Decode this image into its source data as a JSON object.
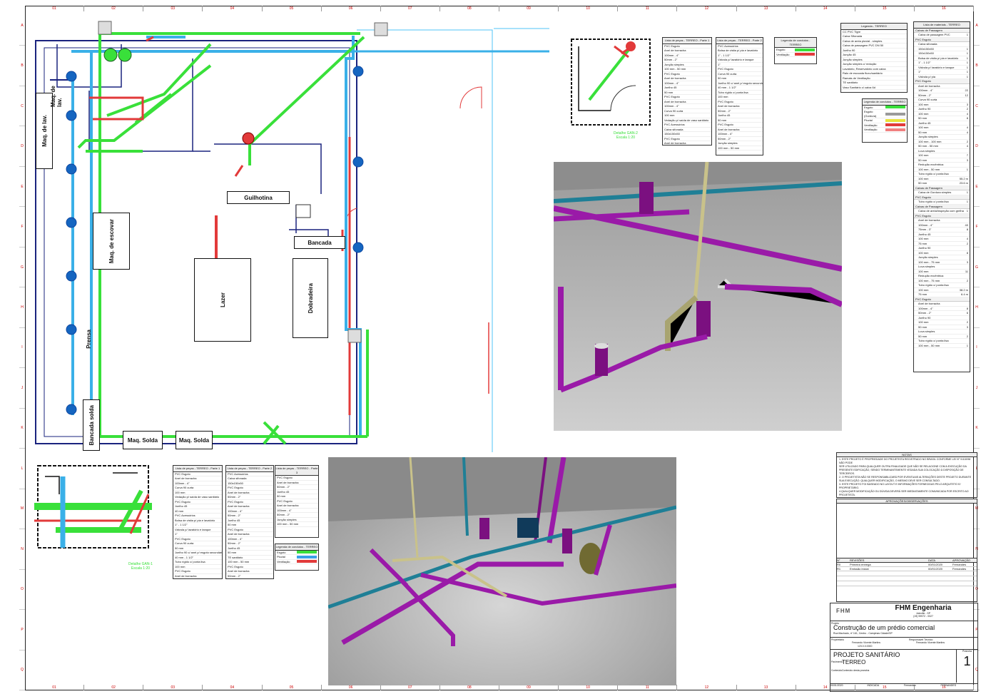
{
  "columns": [
    "01",
    "02",
    "03",
    "04",
    "05",
    "06",
    "07",
    "08",
    "09",
    "10",
    "11",
    "12",
    "13",
    "14",
    "15",
    "16"
  ],
  "rows": [
    "A",
    "B",
    "C",
    "D",
    "E",
    "F",
    "G",
    "H",
    "I",
    "J",
    "K",
    "L",
    "M",
    "N",
    "O",
    "P",
    "Q"
  ],
  "plan": {
    "rooms": {
      "maq_lavar": "Maq. de lav.",
      "maq_lavar2": "Maq. de lav.",
      "maq_escovar": "Maq. de escovar",
      "guilhotina": "Guilhotina",
      "bancada": "Bancada",
      "lazer": "Lazer",
      "dobradeira": "Dobradeira",
      "bancada_solda": "Bancada solda",
      "maq_solda1": "Maq. Solda",
      "maq_solda2": "Maq. Solda",
      "prensa": "Prensa"
    },
    "detail_gan2": {
      "title": "Detalhe GAN-2",
      "scale": "Escala 1:20"
    },
    "detail_gan1": {
      "title": "Detalhe GAN-1",
      "scale": "Escala 1:20"
    }
  },
  "legend_small": {
    "title": "Legenda de condutos - TERREO",
    "items": [
      {
        "label": "Esgoto",
        "color": "#39e03a"
      },
      {
        "label": "Ventilação",
        "color": "#e23a3a"
      }
    ]
  },
  "legend_pipes": {
    "title": "Legenda de condutos - TERREO",
    "items": [
      {
        "label": "Esgoto",
        "color": "#39e03a"
      },
      {
        "label": "Esgoto (Gordura)",
        "color": "#9a9a9a"
      },
      {
        "label": "Pluvial",
        "color": "#e8e23a"
      },
      {
        "label": "Ventilação",
        "color": "#e23a3a"
      },
      {
        "label": "Ventilação",
        "color": "#f08080"
      }
    ]
  },
  "legend_lower": {
    "title": "Legenda de condutos - TERREO",
    "items": [
      {
        "label": "Esgoto",
        "color": "#39e03a"
      },
      {
        "label": "Pluvial",
        "color": "#3aa0e8"
      },
      {
        "label": "Ventilação",
        "color": "#e23a3a"
      }
    ]
  },
  "legend_symbols": {
    "title": "Legenda - TERREO",
    "items": [
      "CC PVC Tigre",
      "Caixa Sifonada",
      "Caixa de areia pluvial - simples",
      "Caixa de passagem PVC DN 50",
      "Joelho 90",
      "Junção 45",
      "Junção simples",
      "Junção simples c/ redução",
      "Lavatório, Reservatório com caixa",
      "Ralo de escoada fluxo/sanitário",
      "Ramais de Ventilação",
      "TE sanitário",
      "Vaso Sanitário c/ caixa 6d"
    ]
  },
  "material_list": {
    "title": "Lista de materiais - TERREO",
    "sections": [
      {
        "head": "Caixas de Passagem",
        "rows": [
          [
            "Caixa de passagem PVC",
            "1"
          ]
        ]
      },
      {
        "head": "PVC Esgoto",
        "rows": [
          [
            "Caixa sifonada",
            ""
          ],
          [
            "150x150x50",
            "1"
          ],
          [
            "150x150x50",
            "1"
          ],
          [
            "Bolsa de visita p/ pia e lavatório",
            "1"
          ],
          [
            "1\" - 1 1/2\"",
            "1"
          ],
          [
            "Válvula p/ lavatório e tanque",
            "1"
          ],
          [
            "1\"",
            "1"
          ],
          [
            "Válvula p/ pia",
            "1"
          ]
        ]
      },
      {
        "head": "PVC Esgoto",
        "rows": [
          [
            "Anel de borracha",
            ""
          ],
          [
            "100mm - 4\"",
            "22"
          ],
          [
            "50mm - 2\"",
            "12"
          ],
          [
            "Curva 90 curta",
            ""
          ],
          [
            "100 mm",
            "3"
          ],
          [
            "Joelho 90",
            "2"
          ],
          [
            "100 mm",
            "4"
          ],
          [
            "50 mm",
            "8"
          ],
          [
            "Joelho 45",
            ""
          ],
          [
            "100 mm",
            "4"
          ],
          [
            "50 mm",
            "4"
          ],
          [
            "Junção simples",
            ""
          ],
          [
            "100 mm - 100 mm",
            "2"
          ],
          [
            "50 mm - 50 mm",
            "4"
          ],
          [
            "Luva simples",
            ""
          ],
          [
            "100 mm",
            "7"
          ],
          [
            "50 mm",
            "3"
          ],
          [
            "Redução excêntrica",
            ""
          ],
          [
            "100 mm - 50 mm",
            "1"
          ],
          [
            "Tubo rígido c/ ponta lisa",
            ""
          ],
          [
            "100 mm",
            "55.2 m"
          ],
          [
            "50 mm",
            "23.6 m"
          ]
        ]
      },
      {
        "head": "Caixas de Passagem",
        "rows": [
          [
            "Caixa de Gordura simples",
            "1"
          ]
        ]
      },
      {
        "head": "PVC Esgoto",
        "rows": [
          [
            "Tubo rígido c/ ponta lisa",
            "1"
          ]
        ]
      },
      {
        "head": "Caixas de Passagem",
        "rows": [
          [
            "Caixa de areia/inspeção com grelha",
            "1"
          ]
        ]
      },
      {
        "head": "PVC Esgoto",
        "rows": [
          [
            "Anel de borracha",
            ""
          ],
          [
            "100mm - 4\"",
            "40"
          ],
          [
            "75mm - 3\"",
            "8"
          ],
          [
            "Joelho 45",
            ""
          ],
          [
            "100 mm",
            "4"
          ],
          [
            "75 mm",
            "2"
          ],
          [
            "Joelho 90",
            ""
          ],
          [
            "100 mm",
            "8"
          ],
          [
            "Junção simples",
            ""
          ],
          [
            "100 mm - 75 mm",
            "3"
          ],
          [
            "Luva simples",
            ""
          ],
          [
            "100 mm",
            "11"
          ],
          [
            "Redução excêntrica",
            ""
          ],
          [
            "100 mm - 75 mm",
            "2"
          ],
          [
            "Tubo rígido c/ ponta lisa",
            ""
          ],
          [
            "100 mm",
            "38.2 m"
          ],
          [
            "75 mm",
            "6.4 m"
          ]
        ]
      },
      {
        "head": "PVC Esgoto",
        "rows": [
          [
            "Anel de borracha",
            ""
          ],
          [
            "100mm - 4\"",
            "8"
          ],
          [
            "50mm - 2\"",
            "6"
          ],
          [
            "Joelho 90",
            ""
          ],
          [
            "100 mm",
            "2"
          ],
          [
            "50 mm",
            "3"
          ],
          [
            "Luva simples",
            ""
          ],
          [
            "50 mm",
            "2"
          ],
          [
            "Tubo rígido c/ ponta lisa",
            ""
          ],
          [
            "100 mm - 50 mm",
            "1"
          ]
        ]
      }
    ]
  },
  "lists_gan2": [
    {
      "title": "Lista de peças - TERREO - Parte 1",
      "rows": [
        "PVC Esgoto",
        "Anel de borracha",
        "100mm - 4\"",
        "50mm - 2\"",
        "Junção simples",
        "100 mm - 50 mm",
        "PVC Esgoto",
        "Anel de borracha",
        "100mm - 4\"",
        "Joelho 45",
        "50 mm",
        "PVC Esgoto",
        "Anel de borracha",
        "100mm - 4\"",
        "Curva 90 curta",
        "100 mm",
        "Vedação p/ saída de vaso sanitário",
        "PVC Acessórios",
        "Caixa sifonada",
        "150x150x50",
        "PVC Esgoto",
        "Anel de borracha",
        "50mm - 2\"",
        "PVC Esgoto",
        "Joelho 45",
        "50 mm"
      ]
    },
    {
      "title": "Lista de peças - TERREO - Parte 2",
      "rows": [
        "PVC Acessórios",
        "Bolsa de visita p/ pia e lavatório",
        "1\" - 1 1/2\"",
        "Válvula p/ lavatório e tanque",
        "1\"",
        "PVC Esgoto",
        "Curva 90 curta",
        "50 mm",
        "Joelho 90 c/ anel p/ esgoto secundário",
        "40 mm - 1 1/2\"",
        "Tubo rígido c/ ponta lisa",
        "100 mm",
        "PVC Esgoto",
        "Anel de borracha",
        "50mm - 2\"",
        "Joelho 45",
        "50 mm",
        "PVC Esgoto",
        "Anel de borracha",
        "100mm - 4\"",
        "50mm - 2\"",
        "Junção simples",
        "100 mm - 50 mm"
      ]
    }
  ],
  "lists_gan1": [
    {
      "title": "Lista de peças - TERREO - Parte 1",
      "rows": [
        "PVC Esgoto",
        "Anel de borracha",
        "100mm - 4\"",
        "Curva 90 curta",
        "100 mm",
        "Vedação p/ saída de vaso sanitário",
        "PVC Esgoto",
        "Joelho 45",
        "40 mm",
        "PVC Acessórios",
        "Bolsa de visita p/ pia e lavatório",
        "1\" - 1 1/2\"",
        "Válvula p/ lavatório e tanque",
        "1\"",
        "PVC Esgoto",
        "Curva 90 curta",
        "50 mm",
        "Joelho 90 c/ anel p/ esgoto secundário",
        "40 mm - 1 1/2\"",
        "Tubo rígido c/ ponta lisa",
        "100 mm",
        "PVC Esgoto",
        "Anel de borracha",
        "50mm - 2\"",
        "Joelho 45",
        "50 mm"
      ]
    },
    {
      "title": "Lista de peças - TERREO - Parte 2",
      "rows": [
        "PVC Acessórios",
        "Caixa sifonada",
        "150x150x50",
        "PVC Esgoto",
        "Anel de borracha",
        "50mm - 2\"",
        "PVC Esgoto",
        "Anel de borracha",
        "100mm - 4\"",
        "50mm - 2\"",
        "Joelho 45",
        "50 mm",
        "PVC Esgoto",
        "Anel de borracha",
        "100mm - 4\"",
        "50mm - 2\"",
        "Joelho 45",
        "50 mm",
        "TE sanitário",
        "100 mm - 50 mm",
        "PVC Esgoto",
        "Anel de borracha",
        "50mm - 2\"",
        "Joelho 45",
        "50 mm"
      ]
    },
    {
      "title": "Lista de peças - TERREO - Parte 3",
      "rows": [
        "PVC Esgoto",
        "Anel de borracha",
        "50mm - 2\"",
        "Joelho 45",
        "50 mm",
        "PVC Esgoto",
        "Anel de borracha",
        "100mm - 4\"",
        "50mm - 2\"",
        "Junção simples",
        "100 mm - 50 mm"
      ]
    }
  ],
  "notes": {
    "title": "NOTAS",
    "lines": [
      "1. ESTE PROJETO É PROPRIEDADE DO PROJETISTA REGISTRADO NO BRASIL CONFORME LEI N° 9.610/98 NÃO PODE",
      "SER UTILIZADO PARA QUALQUER OUTRA FINALIDADE QUE NÃO SE RELACIONE COM A EXECUÇÃO DA",
      "PRESENTE EDIFICAÇÃO, SENDO TERMINANTEMENTE VEDADA SUA COLOCAÇÃO À DISPOSIÇÃO DE TERCEIROS.",
      "2. O PROJETISTA NÃO SE RESPONSABILIZARÁ POR EVENTUAIS ALTERAÇÕES DESTE PROJETO DURANTE",
      "SUA EXECUÇÃO. QUALQUER MODIFICAÇÃO, O MESMO DEVE SER CONSULTADO.",
      "3. ESTE PROJETO FOI BASEADO NO LAYOUT E INFORMAÇÕES FORNECIDAS PELO ARQUITETO E/",
      "PROPRIETÁRIO.",
      "4.QUALQUER MODIFICAÇÃO OU DÚVIDA DEVERÁ SER IMEDIATAMENTE COMUNICADA POR ESCRITO AO PROJETISTA."
    ]
  },
  "approvals": {
    "title": "APROVAÇÕES/OBSERVAÇÕES"
  },
  "revisions": {
    "headers": [
      "N°",
      "REVISÕES",
      "DATA",
      "APROVAÇÃO"
    ],
    "rows": [
      [
        "R0",
        "Primeira entrega",
        "00/01/2020",
        "Fernandes"
      ],
      [
        "R1",
        "Emissão inicial",
        "00/01/2020",
        "Fernandes"
      ]
    ]
  },
  "title_block": {
    "company": "FHM Engenharia",
    "company_sub1": "Joinville - SP",
    "company_sub2": "(19) 99972 - 0027",
    "logo_text": "FHM",
    "project_label": "Projeto",
    "project": "Construção de um prédio comercial",
    "address": "Rua Machado, nº 161, Centro - Campinas Cidade/SP",
    "owner_label": "Proprietário",
    "owner": "Fernando Vicente Martins",
    "owner_doc": "123.0.0.0000",
    "resp_label": "Responsável Técnico",
    "resp": "Fernando Vicente Martins",
    "sheet_title": "PROJETO SANITÁRIO",
    "floor_label": "Pavimento",
    "floor": "TERREO",
    "content_label": "Conteúdo",
    "content": "Conteúdo desta prancha",
    "sheet_label": "Prancha",
    "sheet_no": "1",
    "footer": [
      "00/01/2020",
      "INDICADA",
      "Fernandes",
      "FERNANDES"
    ]
  },
  "colors": {
    "esgoto": "#39e03a",
    "pluvial": "#3ab0e8",
    "ventilacao": "#e23a3a",
    "pipe3d_purple": "#9a1aa8",
    "pipe3d_teal": "#1f7f96",
    "pipe3d_tan": "#c9c28a",
    "wall": "#1a237e"
  }
}
